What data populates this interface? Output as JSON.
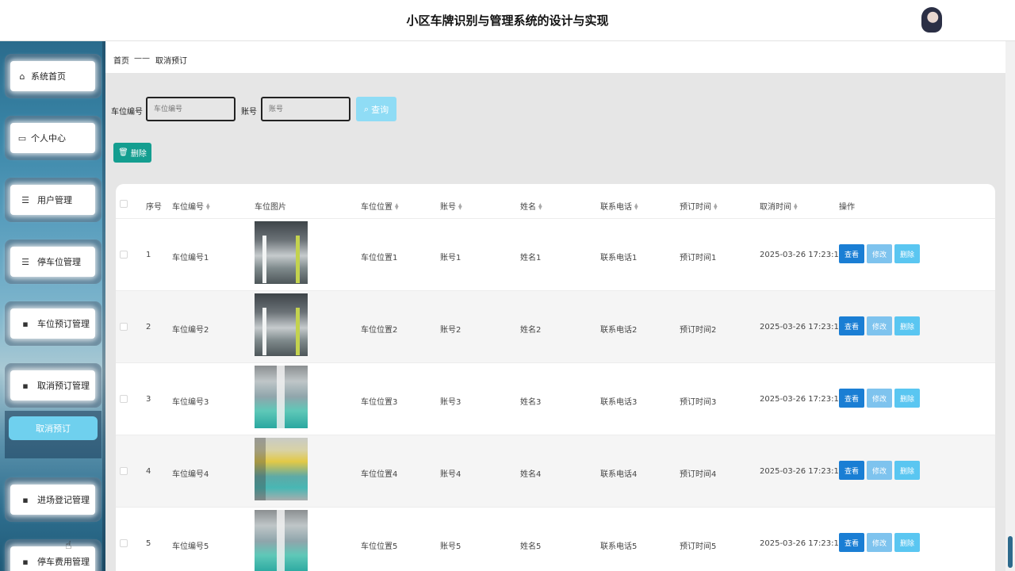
{
  "app": {
    "title": "小区车牌识别与管理系统的设计与实现"
  },
  "sidebar": {
    "items": [
      {
        "label": "系统首页",
        "icon": "home-icon",
        "glyph": "⌂"
      },
      {
        "label": "个人中心",
        "icon": "profile-icon",
        "glyph": "▭"
      },
      {
        "label": "用户管理",
        "icon": "list-icon",
        "glyph": "☰"
      },
      {
        "label": "停车位管理",
        "icon": "sliders-icon",
        "glyph": "☰"
      },
      {
        "label": "车位预订管理",
        "icon": "grid-icon",
        "glyph": "▪"
      },
      {
        "label": "取消预订管理",
        "icon": "grid-icon",
        "glyph": "▪"
      },
      {
        "label": "进场登记管理",
        "icon": "chat-icon",
        "glyph": "▪"
      },
      {
        "label": "停车费用管理",
        "icon": "phone-icon",
        "glyph": "▪"
      }
    ],
    "active_sub": "取消预订"
  },
  "breadcrumb": {
    "home": "首页",
    "separator": "——",
    "current": "取消预订"
  },
  "search": {
    "slot_label": "车位编号",
    "slot_placeholder": "车位编号",
    "account_label": "账号",
    "account_placeholder": "账号",
    "query_label": "查询"
  },
  "toolbar": {
    "delete_label": "删除"
  },
  "table": {
    "columns": [
      "序号",
      "车位编号",
      "车位图片",
      "车位位置",
      "账号",
      "姓名",
      "联系电话",
      "预订时间",
      "取消时间",
      "操作"
    ],
    "actions": {
      "view": "查看",
      "edit": "修改",
      "delete": "删除"
    },
    "rows": [
      {
        "index": "1",
        "slot_no": "车位编号1",
        "image": "garage",
        "location": "车位位置1",
        "account": "账号1",
        "name": "姓名1",
        "phone": "联系电话1",
        "booking_time": "预订时间1",
        "cancel_time": "2025-03-26 17:23:19"
      },
      {
        "index": "2",
        "slot_no": "车位编号2",
        "image": "garage",
        "location": "车位位置2",
        "account": "账号2",
        "name": "姓名2",
        "phone": "联系电话2",
        "booking_time": "预订时间2",
        "cancel_time": "2025-03-26 17:23:19"
      },
      {
        "index": "3",
        "slot_no": "车位编号3",
        "image": "lift",
        "location": "车位位置3",
        "account": "账号3",
        "name": "姓名3",
        "phone": "联系电话3",
        "booking_time": "预订时间3",
        "cancel_time": "2025-03-26 17:23:19"
      },
      {
        "index": "4",
        "slot_no": "车位编号4",
        "image": "yellow",
        "location": "车位位置4",
        "account": "账号4",
        "name": "姓名4",
        "phone": "联系电话4",
        "booking_time": "预订时间4",
        "cancel_time": "2025-03-26 17:23:19"
      },
      {
        "index": "5",
        "slot_no": "车位编号5",
        "image": "lift",
        "location": "车位位置5",
        "account": "账号5",
        "name": "姓名5",
        "phone": "联系电话5",
        "booking_time": "预订时间5",
        "cancel_time": "2025-03-26 17:23:19"
      }
    ]
  },
  "colors": {
    "primary": "#1a7ed4",
    "teal": "#149e90",
    "sky": "#6fd0ee"
  }
}
